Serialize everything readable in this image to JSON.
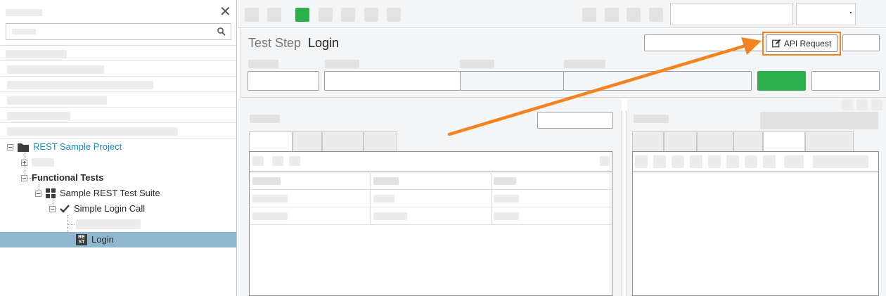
{
  "navigator": {
    "close_glyph": "✕",
    "tree": {
      "project": "REST Sample Project",
      "functional_tests": "Functional Tests",
      "suite": "Sample REST Test Suite",
      "test_case": "Simple Login Call",
      "step": "Login",
      "rest_badge_top": "RE",
      "rest_badge_bottom": "ST"
    }
  },
  "step_header": {
    "kind": "Test Step",
    "name": "Login",
    "api_request_label": "API Request"
  },
  "colors": {
    "project_link": "#1e8fb8",
    "accent_green": "#2cae4a",
    "highlight_orange": "#f5831f",
    "selected_row": "#8fb7d0"
  },
  "icons": [
    "close-icon",
    "search-icon",
    "folder-icon",
    "suite-grid-icon",
    "checkmark-icon",
    "rest-step-icon",
    "edit-icon",
    "arrow-annotation"
  ]
}
